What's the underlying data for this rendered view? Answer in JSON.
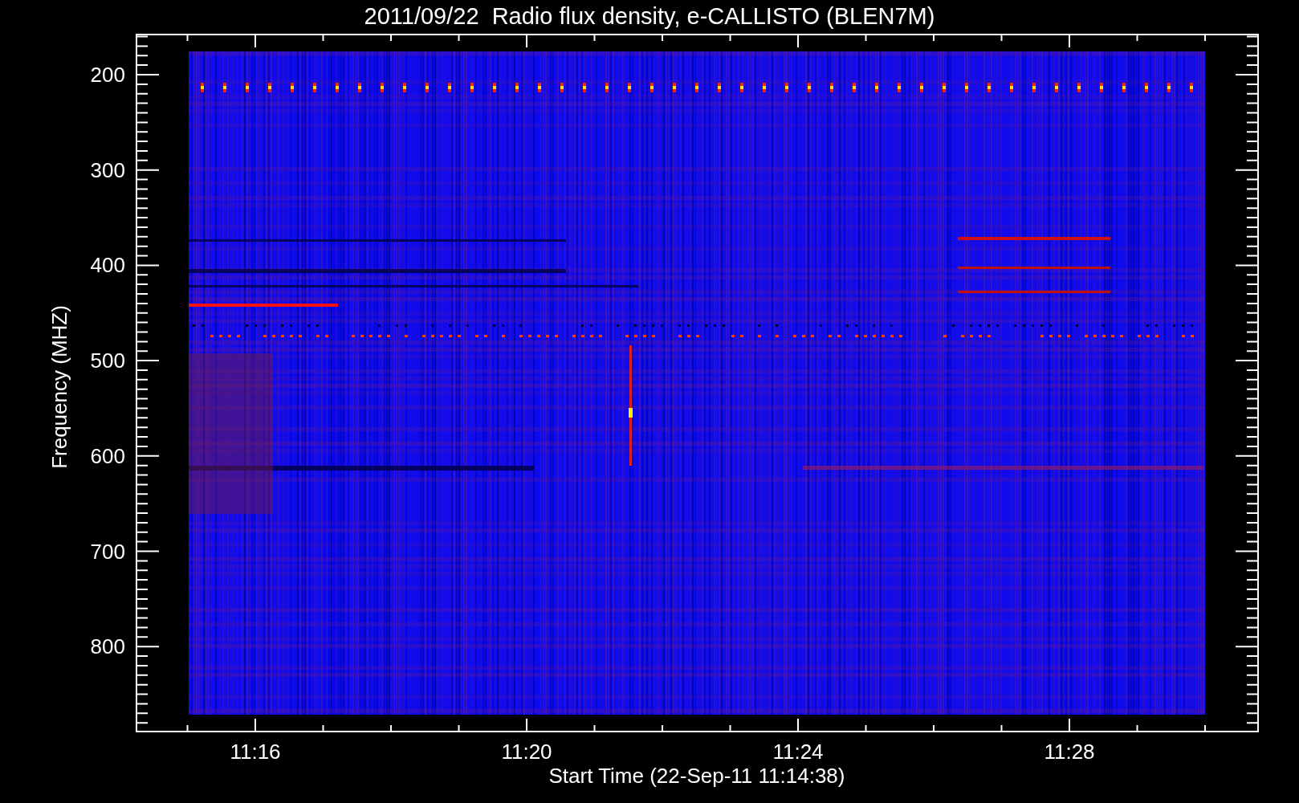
{
  "title": "2011/09/22  Radio flux density, e-CALLISTO (BLEN7M)",
  "y_axis": {
    "label": "Frequency (MHZ)",
    "ticks": [
      "200",
      "300",
      "400",
      "500",
      "600",
      "700",
      "800"
    ]
  },
  "x_axis": {
    "label": "Start Time (22-Sep-11 11:14:38)",
    "ticks": [
      "11:16",
      "11:20",
      "11:24",
      "11:28"
    ]
  }
}
